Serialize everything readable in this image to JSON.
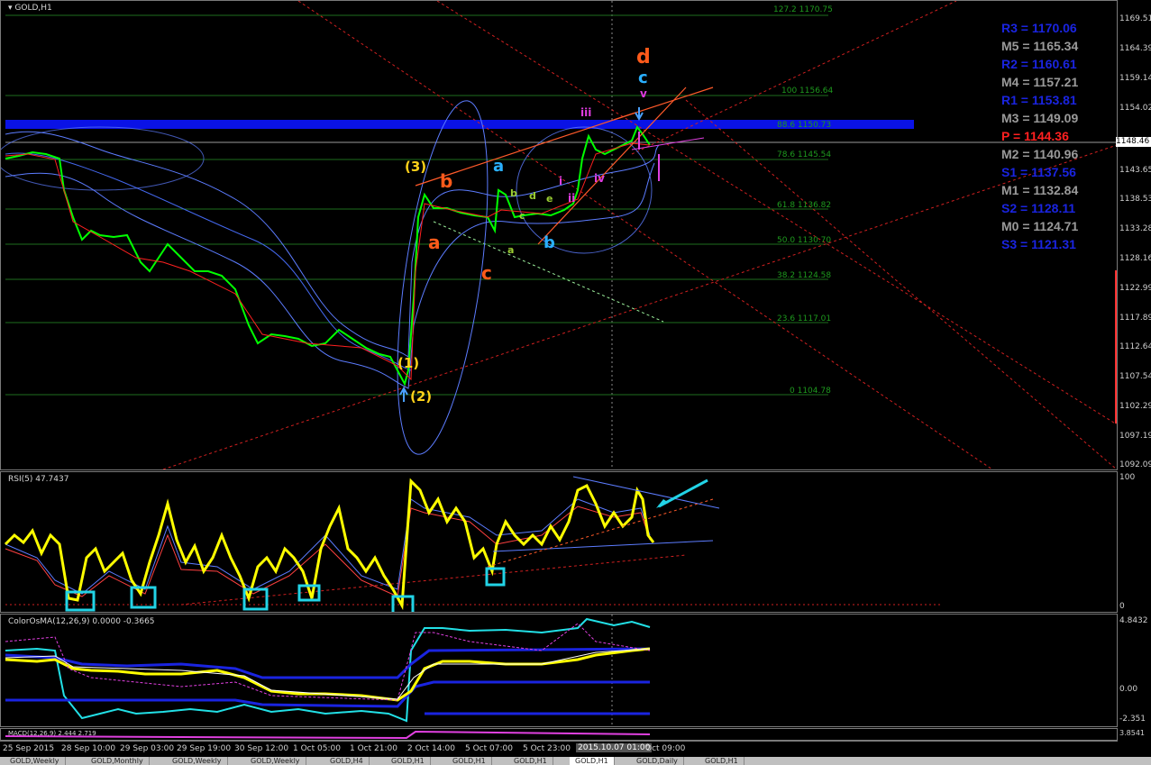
{
  "chart_title": "GOLD,H1",
  "rsi_label": "RSI(5) 47.7437",
  "osma_label": "ColorOsMA(12,26,9) 0.0000 -0.3665",
  "macd_label": "MACD(12,26,9) 2.444 2.719",
  "current_price": "1148.46",
  "price_ticks": [
    "1169.51",
    "1164.39",
    "1159.14",
    "1154.02",
    "1148.77",
    "1143.65",
    "1138.53",
    "1133.28",
    "1128.16",
    "1122.99",
    "1117.89",
    "1112.64",
    "1107.54",
    "1102.29",
    "1097.19",
    "1092.09"
  ],
  "rsi_ticks": [
    "100",
    "0"
  ],
  "osma_ticks": [
    "4.8432",
    "0.00",
    "-2.351"
  ],
  "macd_ticks": [
    "3.8541"
  ],
  "fib_levels": [
    "127.2 1170.75",
    "100 1156.64",
    "88.6 1150.73",
    "78.6 1145.54",
    "61.8 1136.82",
    "50.0 1130.70",
    "38.2 1124.58",
    "23.6 1117.01",
    "0 1104.78"
  ],
  "pivots": [
    {
      "label": "R3 = 1170.06",
      "color": "#1a24e0"
    },
    {
      "label": "M5 = 1165.34",
      "color": "#9a9a9a"
    },
    {
      "label": "R2 = 1160.61",
      "color": "#1a24e0"
    },
    {
      "label": "M4 = 1157.21",
      "color": "#9a9a9a"
    },
    {
      "label": "R1 = 1153.81",
      "color": "#1a24e0"
    },
    {
      "label": "M3 = 1149.09",
      "color": "#9a9a9a"
    },
    {
      "label": "P  = 1144.36",
      "color": "#ff2020"
    },
    {
      "label": "M2 = 1140.96",
      "color": "#9a9a9a"
    },
    {
      "label": "S1 = 1137.56",
      "color": "#1a24e0"
    },
    {
      "label": "M1 = 1132.84",
      "color": "#9a9a9a"
    },
    {
      "label": "S2 = 1128.11",
      "color": "#1a24e0"
    },
    {
      "label": "M0 = 1124.71",
      "color": "#9a9a9a"
    },
    {
      "label": "S3 = 1121.31",
      "color": "#1a24e0"
    }
  ],
  "wave_labels": {
    "w3": "(3)",
    "w1": "(1)",
    "w2": "(2)",
    "a_red": "a",
    "b_red": "b",
    "c_red": "c",
    "d_red": "d",
    "a_blue": "a",
    "b_blue": "b",
    "c_blue": "c",
    "i": "i",
    "ii": "ii",
    "iii": "iii",
    "iv": "iv",
    "v": "v",
    "sa": "a",
    "sb": "b",
    "sc": "c",
    "sd": "d",
    "se": "e",
    "sa2": "a"
  },
  "time_labels": [
    "25 Sep 2015",
    "28 Sep 10:00",
    "29 Sep 03:00",
    "29 Sep 19:00",
    "30 Sep 12:00",
    "1 Oct 05:00",
    "1 Oct 21:00",
    "2 Oct 14:00",
    "5 Oct 07:00",
    "5 Oct 23:00",
    "2015.10.07 01:00",
    "Oct 09:00"
  ],
  "tabs": [
    "GOLD,Weekly",
    "GOLD,Monthly",
    "GOLD,Weekly",
    "GOLD,Weekly",
    "GOLD,H4",
    "GOLD,H1",
    "GOLD,H1",
    "GOLD,H1",
    "GOLD,H1",
    "GOLD,Daily",
    "GOLD,H1"
  ],
  "active_tab_index": 8,
  "colors": {
    "candle": "#00ff00",
    "bollinger": "#5c7cff",
    "fib": "#1e8a1e",
    "pivot_band": "#0a12e6",
    "rsi": "#ffff00",
    "box": "#22d3e6"
  }
}
